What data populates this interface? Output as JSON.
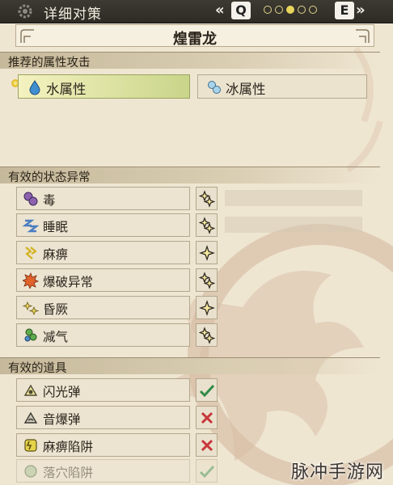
{
  "header": {
    "title": "详细对策",
    "prev_key": "Q",
    "next_key": "E",
    "prev_chevron": "«",
    "next_chevron": "»",
    "page_dots_total": 5,
    "page_dots_active": 3
  },
  "monster": {
    "name": "煌雷龙"
  },
  "sections": {
    "elements": "推荐的属性攻击",
    "ailments": "有效的状态异常",
    "items": "有效的道具"
  },
  "elements": [
    {
      "label": "水属性",
      "icon": "water-drop-icon",
      "selected": true
    },
    {
      "label": "冰属性",
      "icon": "ice-icon",
      "selected": false
    }
  ],
  "ailments": [
    {
      "label": "毒",
      "icon": "poison-icon",
      "effectiveness": "2-stars"
    },
    {
      "label": "睡眠",
      "icon": "sleep-icon",
      "effectiveness": "2-stars"
    },
    {
      "label": "麻痹",
      "icon": "paralysis-icon",
      "effectiveness": "1-star"
    },
    {
      "label": "爆破异常",
      "icon": "blast-icon",
      "effectiveness": "2-stars"
    },
    {
      "label": "昏厥",
      "icon": "stun-icon",
      "effectiveness": "1-star"
    },
    {
      "label": "减气",
      "icon": "exhaust-icon",
      "effectiveness": "2-stars"
    }
  ],
  "items": [
    {
      "label": "闪光弹",
      "icon": "flash-pod-icon",
      "status": "check"
    },
    {
      "label": "音爆弹",
      "icon": "sonic-bomb-icon",
      "status": "cross"
    },
    {
      "label": "麻痹陷阱",
      "icon": "shock-trap-icon",
      "status": "cross"
    },
    {
      "label": "落穴陷阱",
      "icon": "pitfall-trap-icon",
      "status": "check"
    }
  ],
  "watermark": "脉冲手游网",
  "colors": {
    "background": "#efe6d2",
    "topbar": "#36332c",
    "selected_gradient_end": "#c9d58a",
    "star": "#f5e9a0",
    "check": "#2f8b46",
    "cross": "#c8373a"
  }
}
